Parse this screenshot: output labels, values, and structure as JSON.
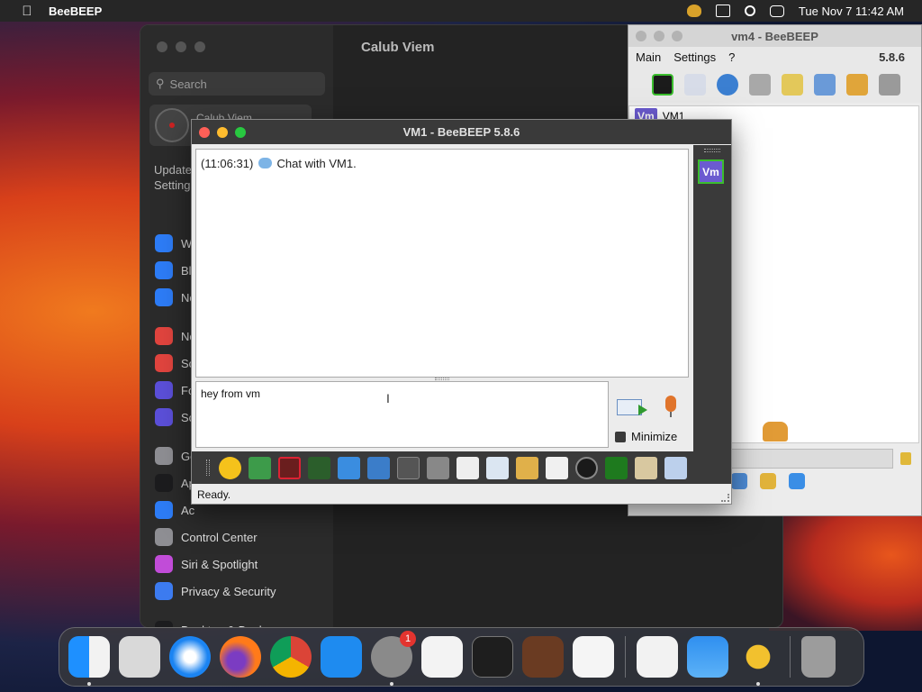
{
  "menubar": {
    "app_name": "BeeBEEP",
    "datetime": "Tue Nov 7  11:42 AM"
  },
  "settings_window": {
    "search_placeholder": "Search",
    "profile_name": "Calub Viem",
    "main_title": "Calub Viem",
    "notice": "Update\nSettings",
    "items": [
      {
        "label": "Wi",
        "color": "#2d7cf6"
      },
      {
        "label": "Bl",
        "color": "#2d7cf6"
      },
      {
        "label": "Ne",
        "color": "#2d7cf6"
      },
      {
        "label": "No",
        "color": "#e0443e"
      },
      {
        "label": "So",
        "color": "#e0443e"
      },
      {
        "label": "Fo",
        "color": "#5b4fd8"
      },
      {
        "label": "Sc",
        "color": "#5b4fd8"
      },
      {
        "label": "Ge",
        "color": "#8e8e93"
      },
      {
        "label": "Ap",
        "color": "#1c1c1e"
      },
      {
        "label": "Ac",
        "color": "#2d7cf6"
      },
      {
        "label": "Control Center",
        "color": "#8e8e93"
      },
      {
        "label": "Siri & Spotlight",
        "color": "#c14cd8"
      },
      {
        "label": "Privacy & Security",
        "color": "#3c7bf0"
      },
      {
        "label": "Desktop & Dock",
        "color": "#1c1c1e"
      }
    ]
  },
  "vm4_window": {
    "title": "vm4 - BeeBEEP",
    "menu": [
      "Main",
      "Settings",
      "?"
    ],
    "version": "5.8.6",
    "list_row": "VM1",
    "badge": "Vm"
  },
  "vm1_window": {
    "title": "VM1 - BeeBEEP 5.8.6",
    "history_time": "(11:06:31)",
    "history_text": "Chat with VM1.",
    "compose_text": "hey from vm",
    "minimize_label": "Minimize",
    "status": "Ready.",
    "user_badge": "Vm"
  },
  "dock": {
    "settings_badge": "1",
    "apps": [
      "finder",
      "launchpad",
      "safari",
      "firefox",
      "chrome",
      "app-store",
      "system-settings",
      "textedit",
      "terminal",
      "garageband",
      "vscode",
      "visual-studio",
      "weather",
      "beebeep",
      "trash"
    ]
  },
  "colors": {
    "close": "#ff5f57",
    "minimize": "#febc2e",
    "zoom": "#28c840",
    "vm_badge": "#6b5bd0",
    "highlight_green": "#3bbd2e"
  }
}
